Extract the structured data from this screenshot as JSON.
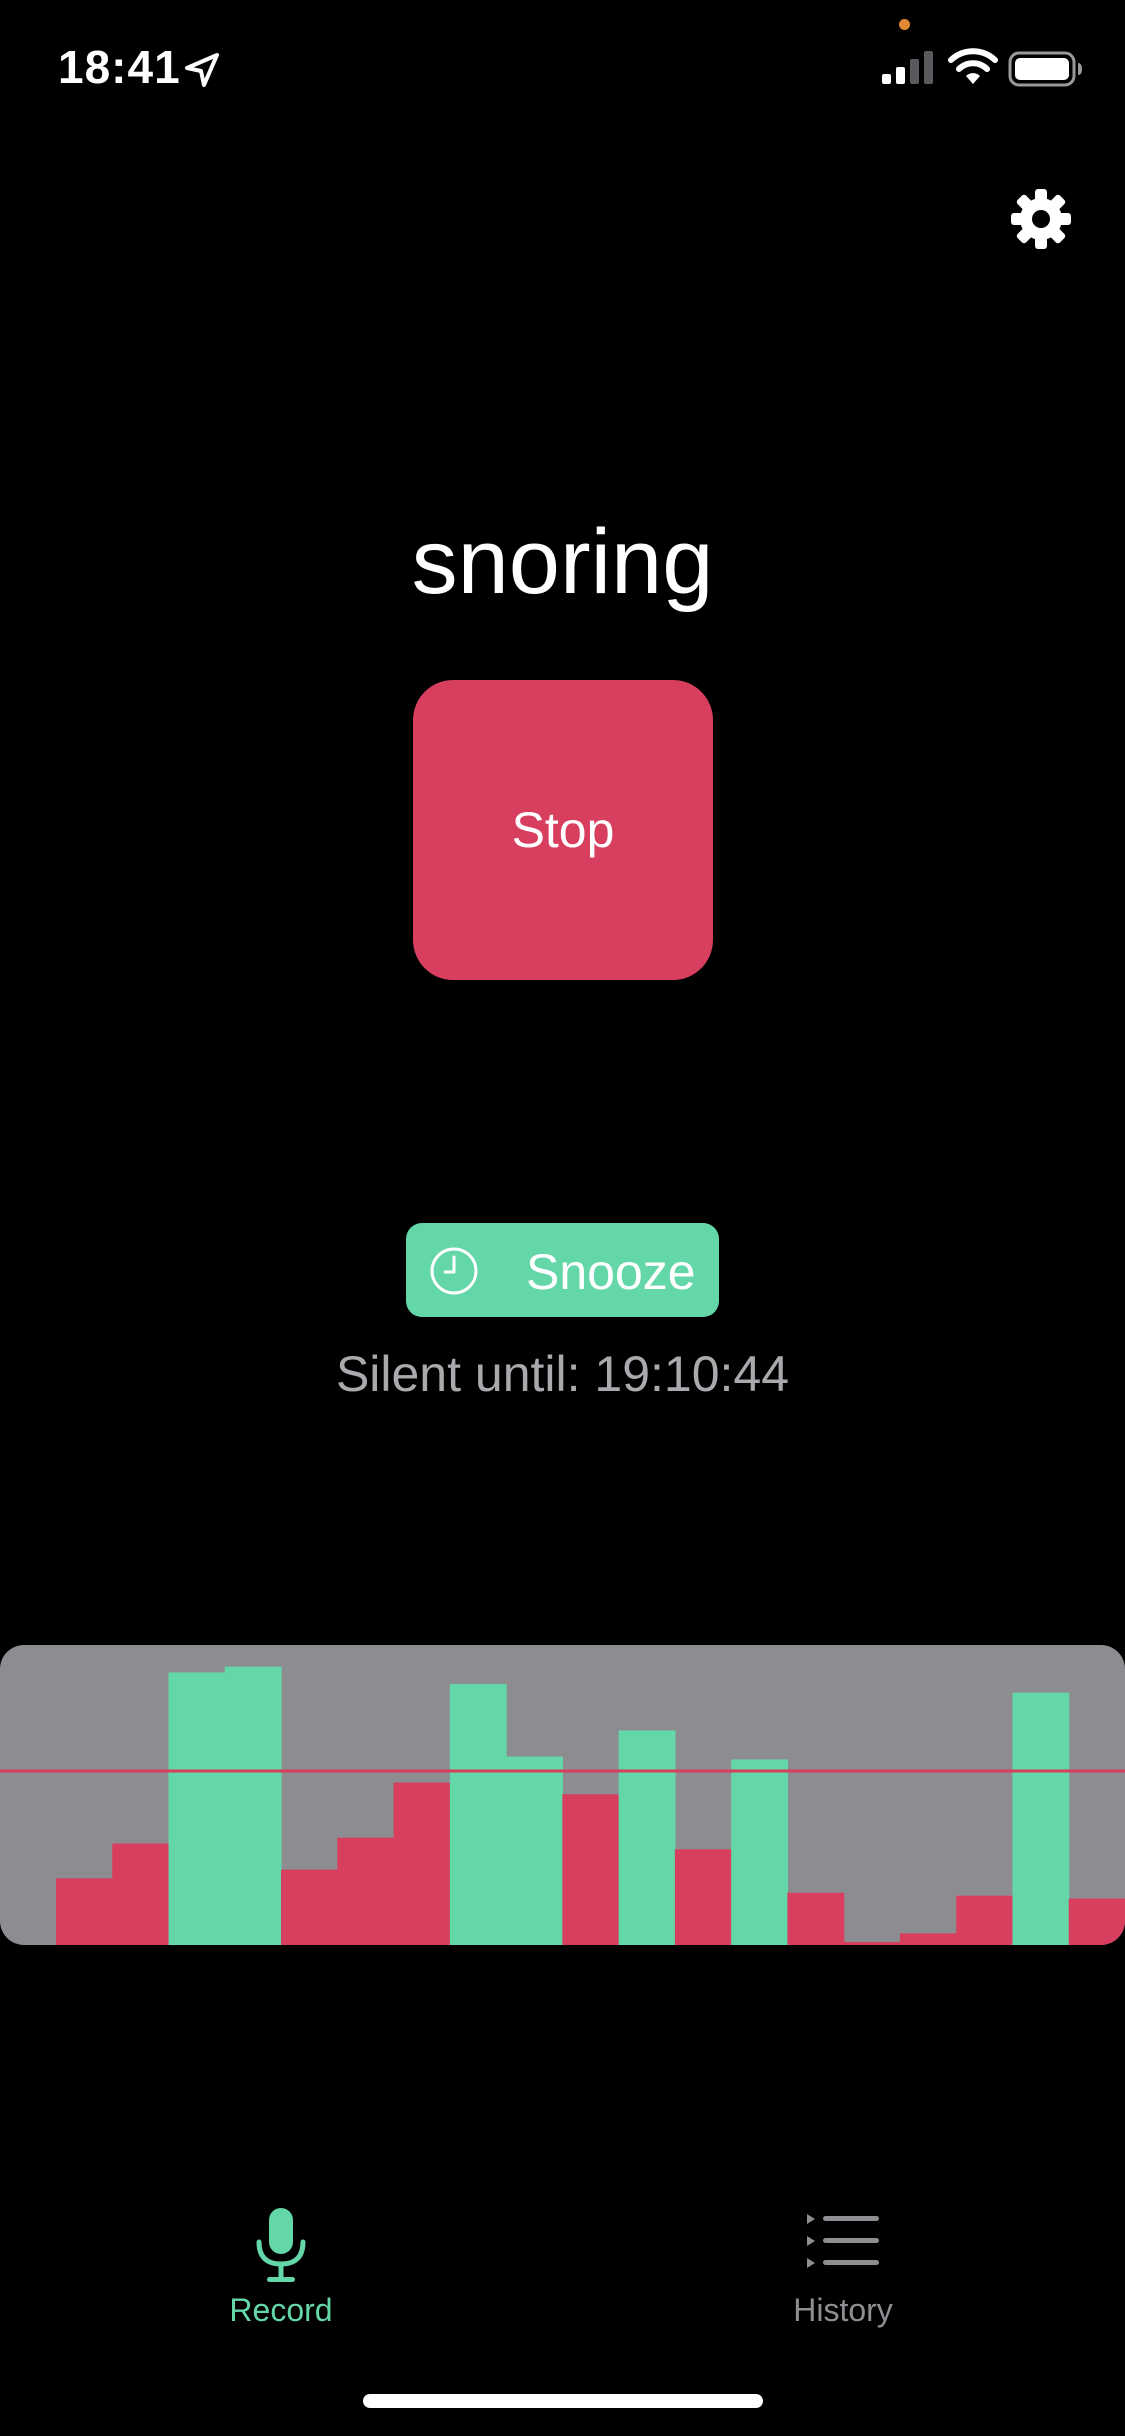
{
  "status_bar": {
    "time": "18:41",
    "icons": [
      "location-arrow-icon",
      "cellular-signal-icon",
      "wifi-icon",
      "battery-icon"
    ]
  },
  "settings": {
    "icon": "gear-icon"
  },
  "detection": {
    "label": "snoring"
  },
  "controls": {
    "stop_label": "Stop",
    "snooze_label": "Snooze",
    "snooze_icon": "clock-icon",
    "silent_until": "Silent until: 19:10:44"
  },
  "colors": {
    "background": "#000000",
    "stop": "#d83e5e",
    "snooze": "#64d7a8",
    "chart_background": "#8d8d91",
    "above_threshold": "#64d7a8",
    "below_threshold": "#d83e5e",
    "threshold_line": "#d83e5e",
    "tab_active": "#64d7a8",
    "tab_inactive": "#8e8e93",
    "silent_text": "#a9a9ae"
  },
  "chart_data": {
    "type": "bar",
    "ylim": [
      0,
      100
    ],
    "threshold": 60,
    "values": [
      23,
      35,
      94,
      96,
      26,
      37,
      56,
      90,
      65,
      52,
      74,
      33,
      64,
      18,
      1,
      4,
      17,
      87,
      16
    ],
    "grid": false
  },
  "tabs": [
    {
      "label": "Record",
      "icon": "microphone-icon",
      "active": true
    },
    {
      "label": "History",
      "icon": "list-icon",
      "active": false
    }
  ]
}
